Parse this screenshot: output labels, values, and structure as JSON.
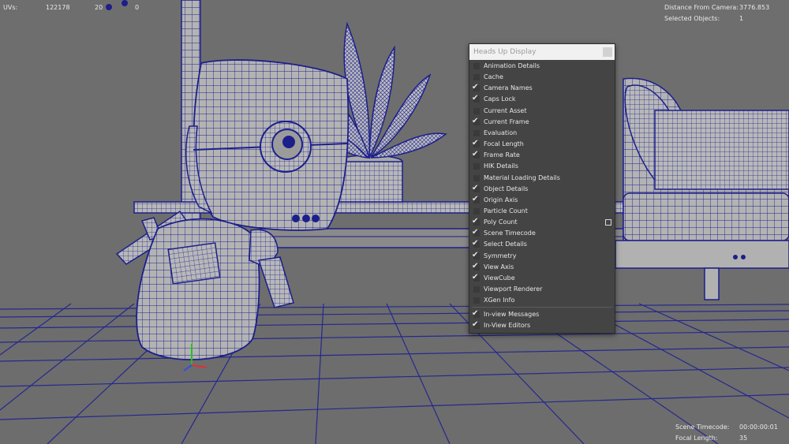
{
  "hud": {
    "uvs_label": "UVs:",
    "uvs_value": "122178",
    "uvs_extra": "20",
    "uvs_extra2": "0",
    "distance_label": "Distance From Camera:",
    "distance_value": "3776.853",
    "selected_label": "Selected Objects:",
    "selected_value": "1",
    "timecode_label": "Scene Timecode:",
    "timecode_value": "00:00:00:01",
    "focal_label": "Focal Length:",
    "focal_value": "35"
  },
  "menu": {
    "title": "Heads Up Display",
    "items": [
      {
        "label": "Animation Details",
        "checked": false
      },
      {
        "label": "Cache",
        "checked": false
      },
      {
        "label": "Camera Names",
        "checked": true
      },
      {
        "label": "Caps Lock",
        "checked": true
      },
      {
        "label": "Current Asset",
        "checked": false
      },
      {
        "label": "Current Frame",
        "checked": true
      },
      {
        "label": "Evaluation",
        "checked": false
      },
      {
        "label": "Focal Length",
        "checked": true
      },
      {
        "label": "Frame Rate",
        "checked": true
      },
      {
        "label": "HIK Details",
        "checked": false
      },
      {
        "label": "Material Loading Details",
        "checked": false
      },
      {
        "label": "Object Details",
        "checked": true
      },
      {
        "label": "Origin Axis",
        "checked": true
      },
      {
        "label": "Particle Count",
        "checked": false
      },
      {
        "label": "Poly Count",
        "checked": true,
        "option_box": true
      },
      {
        "label": "Scene Timecode",
        "checked": true
      },
      {
        "label": "Select Details",
        "checked": true
      },
      {
        "label": "Symmetry",
        "checked": true
      },
      {
        "label": "View Axis",
        "checked": true
      },
      {
        "label": "ViewCube",
        "checked": true
      },
      {
        "label": "Viewport Renderer",
        "checked": false
      },
      {
        "label": "XGen Info",
        "checked": false
      },
      {
        "label": "In-view Messages",
        "checked": true
      },
      {
        "label": "In-View Editors",
        "checked": true
      }
    ]
  },
  "colors": {
    "wire": "#1c1f8a",
    "surface": "#a9a9a9",
    "background": "#6f6f6f"
  }
}
